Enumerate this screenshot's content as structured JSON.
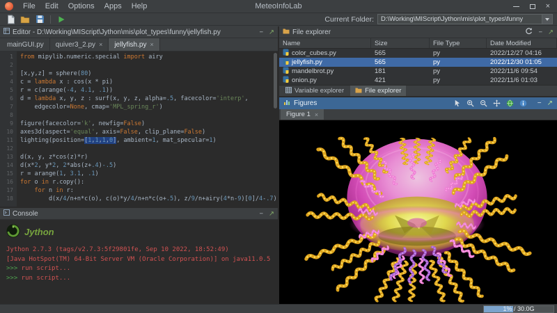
{
  "titlebar": {
    "app_title": "MeteoInfoLab",
    "menus": [
      "File",
      "Edit",
      "Options",
      "Apps",
      "Help"
    ]
  },
  "icons": {
    "minimize": "−",
    "float": "↗",
    "close": "×"
  },
  "toolbar": {
    "current_folder_label": "Current Folder:",
    "current_folder_value": "D:\\Working\\MIScript\\Jython\\mis\\plot_types\\funny"
  },
  "editor": {
    "title": "Editor - D:\\Working\\MIScript\\Jython\\mis\\plot_types\\funny\\jellyfish.py",
    "tabs": [
      {
        "label": "mainGUI.py",
        "closable": false,
        "active": false
      },
      {
        "label": "quiver3_2.py",
        "closable": true,
        "active": false
      },
      {
        "label": "jellyfish.py",
        "closable": true,
        "active": true
      }
    ],
    "lines": [
      {
        "t": [
          [
            "k",
            "from"
          ],
          [
            "p",
            " mipylib.numeric.special "
          ],
          [
            "k",
            "import"
          ],
          [
            "p",
            " airy"
          ]
        ]
      },
      {
        "t": []
      },
      {
        "t": [
          [
            "p",
            "[x,y,z] = sphere("
          ],
          [
            "n",
            "80"
          ],
          [
            "p",
            ")"
          ]
        ]
      },
      {
        "t": [
          [
            "p",
            "c = "
          ],
          [
            "k",
            "lambda"
          ],
          [
            "p",
            " x : cos(x * pi)"
          ]
        ]
      },
      {
        "t": [
          [
            "p",
            "r = c(arange("
          ],
          [
            "n",
            "-4"
          ],
          [
            "p",
            ", "
          ],
          [
            "n",
            "4.1"
          ],
          [
            "p",
            ", "
          ],
          [
            "n",
            ".1"
          ],
          [
            "p",
            "))"
          ]
        ]
      },
      {
        "t": [
          [
            "p",
            "d = "
          ],
          [
            "k",
            "lambda"
          ],
          [
            "p",
            " x, y, z : surf(x, y, z, alpha="
          ],
          [
            "n",
            ".5"
          ],
          [
            "p",
            ", facecolor="
          ],
          [
            "s",
            "'interp'"
          ],
          [
            "p",
            ","
          ]
        ]
      },
      {
        "t": [
          [
            "p",
            "    edgecolor="
          ],
          [
            "k",
            "None"
          ],
          [
            "p",
            ", cmap="
          ],
          [
            "s",
            "'MPL_spring_r'"
          ],
          [
            "p",
            ")"
          ]
        ]
      },
      {
        "t": []
      },
      {
        "t": [
          [
            "p",
            "figure(facecolor="
          ],
          [
            "s",
            "'k'"
          ],
          [
            "p",
            ", newfig="
          ],
          [
            "k",
            "False"
          ],
          [
            "p",
            ")"
          ]
        ]
      },
      {
        "t": [
          [
            "p",
            "axes3d(aspect="
          ],
          [
            "s",
            "'equal'"
          ],
          [
            "p",
            ", axis="
          ],
          [
            "k",
            "False"
          ],
          [
            "p",
            ", clip_plane="
          ],
          [
            "k",
            "False"
          ],
          [
            "p",
            ")"
          ]
        ]
      },
      {
        "t": [
          [
            "p",
            "lighting(position="
          ],
          [
            "hp",
            "["
          ],
          [
            "hn",
            "1"
          ],
          [
            "hp",
            ","
          ],
          [
            "hn",
            "1"
          ],
          [
            "hp",
            ","
          ],
          [
            "hn",
            "1"
          ],
          [
            "hp",
            ","
          ],
          [
            "hn",
            "0"
          ],
          [
            "hp",
            "]"
          ],
          [
            "p",
            ", ambient="
          ],
          [
            "n",
            "1"
          ],
          [
            "p",
            ", mat_specular="
          ],
          [
            "n",
            "1"
          ],
          [
            "p",
            ")"
          ]
        ]
      },
      {
        "t": []
      },
      {
        "t": [
          [
            "p",
            "d(x, y, z*cos(z)*r)"
          ]
        ]
      },
      {
        "t": [
          [
            "p",
            "d(x*"
          ],
          [
            "n",
            "2"
          ],
          [
            "p",
            ", y*"
          ],
          [
            "n",
            "2"
          ],
          [
            "p",
            ", "
          ],
          [
            "n",
            "2"
          ],
          [
            "p",
            "*abs(z+"
          ],
          [
            "n",
            ".4"
          ],
          [
            "p",
            ")"
          ],
          [
            "n",
            "-.5"
          ],
          [
            "p",
            ")"
          ]
        ]
      },
      {
        "t": [
          [
            "p",
            "r = arange("
          ],
          [
            "n",
            "1"
          ],
          [
            "p",
            ", "
          ],
          [
            "n",
            "3.1"
          ],
          [
            "p",
            ", "
          ],
          [
            "n",
            ".1"
          ],
          [
            "p",
            ")"
          ]
        ]
      },
      {
        "t": [
          [
            "k",
            "for"
          ],
          [
            "p",
            " o "
          ],
          [
            "k",
            "in"
          ],
          [
            "p",
            " r.copy():"
          ]
        ]
      },
      {
        "t": [
          [
            "p",
            "    "
          ],
          [
            "k",
            "for"
          ],
          [
            "p",
            " n "
          ],
          [
            "k",
            "in"
          ],
          [
            "p",
            " r:"
          ]
        ]
      },
      {
        "t": [
          [
            "p",
            "        d(x/"
          ],
          [
            "n",
            "4"
          ],
          [
            "p",
            "/n+n*c(o), c(o)*y/"
          ],
          [
            "n",
            "4"
          ],
          [
            "p",
            "/n+n*c(o+"
          ],
          [
            "n",
            ".5"
          ],
          [
            "p",
            "), z/"
          ],
          [
            "n",
            "9"
          ],
          [
            "p",
            "/n+airy("
          ],
          [
            "n",
            "4"
          ],
          [
            "p",
            "*n-"
          ],
          [
            "n",
            "9"
          ],
          [
            "p",
            ")["
          ],
          [
            "n",
            "0"
          ],
          [
            "p",
            "]/"
          ],
          [
            "n",
            "4"
          ],
          [
            "p",
            "-"
          ],
          [
            "n",
            ".7"
          ],
          [
            "p",
            ")"
          ]
        ]
      }
    ]
  },
  "console": {
    "title": "Console",
    "logo_text": "Jython",
    "lines": [
      {
        "text": "Jython 2.7.3 (tags/v2.7.3:5f29801fe, Sep 10 2022, 18:52:49)"
      },
      {
        "text": "[Java HotSpot(TM) 64-Bit Server VM (Oracle Corporation)] on java11.0.5"
      },
      {
        "prompt": ">>>",
        "text": " run script..."
      },
      {
        "prompt": ">>>",
        "text": " run script..."
      }
    ]
  },
  "file_explorer": {
    "title": "File explorer",
    "columns": [
      "Name",
      "Size",
      "File Type",
      "Date Modified"
    ],
    "rows": [
      {
        "name": "color_cubes.py",
        "size": "565",
        "type": "py",
        "modified": "2022/12/27 04:16",
        "selected": false
      },
      {
        "name": "jellyfish.py",
        "size": "565",
        "type": "py",
        "modified": "2022/12/30 01:05",
        "selected": true
      },
      {
        "name": "mandelbrot.py",
        "size": "181",
        "type": "py",
        "modified": "2022/11/6 09:54",
        "selected": false
      },
      {
        "name": "onion.py",
        "size": "421",
        "type": "py",
        "modified": "2022/11/6 01:03",
        "selected": false
      }
    ],
    "bottom_tabs": [
      {
        "label": "Variable explorer",
        "active": false
      },
      {
        "label": "File explorer",
        "active": true
      }
    ]
  },
  "figures": {
    "title": "Figures",
    "tab": "Figure 1"
  },
  "statusbar": {
    "memory": "1% / 30.0G"
  }
}
